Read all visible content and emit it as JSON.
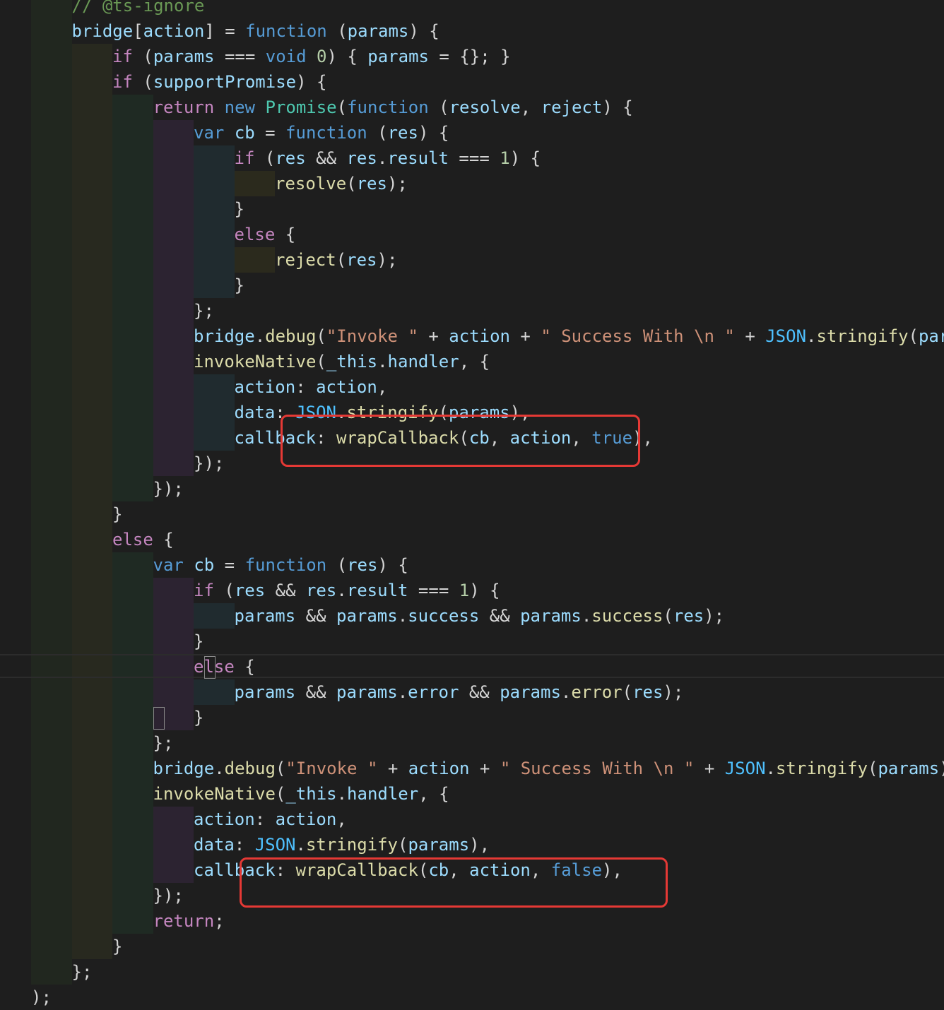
{
  "colors": {
    "background": "#1e1e1e",
    "text": "#d4d4d4",
    "comment": "#6a9955",
    "keyword": "#569cd6",
    "control": "#c586c0",
    "function": "#dcdcaa",
    "variable": "#9cdcfe",
    "string": "#ce9178",
    "number": "#b5cea8",
    "class": "#4ec9b0",
    "constant": "#4fc1ff",
    "highlight_box": "#e53935"
  },
  "lines": [
    {
      "indent": 1,
      "tokens": [
        {
          "t": "// @ts-ignore",
          "c": "comment"
        }
      ]
    },
    {
      "indent": 1,
      "tokens": [
        {
          "t": "bridge",
          "c": "variable"
        },
        {
          "t": "[",
          "c": "text"
        },
        {
          "t": "action",
          "c": "variable"
        },
        {
          "t": "] = ",
          "c": "text"
        },
        {
          "t": "function",
          "c": "keyword"
        },
        {
          "t": " (",
          "c": "text"
        },
        {
          "t": "params",
          "c": "variable"
        },
        {
          "t": ") {",
          "c": "text"
        }
      ]
    },
    {
      "indent": 2,
      "tokens": [
        {
          "t": "if",
          "c": "control"
        },
        {
          "t": " (",
          "c": "text"
        },
        {
          "t": "params",
          "c": "variable"
        },
        {
          "t": " === ",
          "c": "text"
        },
        {
          "t": "void",
          "c": "keyword"
        },
        {
          "t": " ",
          "c": "text"
        },
        {
          "t": "0",
          "c": "number"
        },
        {
          "t": ") { ",
          "c": "text"
        },
        {
          "t": "params",
          "c": "variable"
        },
        {
          "t": " = {}; }",
          "c": "text"
        }
      ]
    },
    {
      "indent": 2,
      "tokens": [
        {
          "t": "if",
          "c": "control"
        },
        {
          "t": " (",
          "c": "text"
        },
        {
          "t": "supportPromise",
          "c": "variable"
        },
        {
          "t": ") {",
          "c": "text"
        }
      ]
    },
    {
      "indent": 3,
      "tokens": [
        {
          "t": "return",
          "c": "control"
        },
        {
          "t": " ",
          "c": "text"
        },
        {
          "t": "new",
          "c": "keyword"
        },
        {
          "t": " ",
          "c": "text"
        },
        {
          "t": "Promise",
          "c": "class"
        },
        {
          "t": "(",
          "c": "text"
        },
        {
          "t": "function",
          "c": "keyword"
        },
        {
          "t": " (",
          "c": "text"
        },
        {
          "t": "resolve",
          "c": "variable"
        },
        {
          "t": ", ",
          "c": "text"
        },
        {
          "t": "reject",
          "c": "variable"
        },
        {
          "t": ") {",
          "c": "text"
        }
      ]
    },
    {
      "indent": 4,
      "tokens": [
        {
          "t": "var",
          "c": "keyword"
        },
        {
          "t": " ",
          "c": "text"
        },
        {
          "t": "cb",
          "c": "variable"
        },
        {
          "t": " = ",
          "c": "text"
        },
        {
          "t": "function",
          "c": "keyword"
        },
        {
          "t": " (",
          "c": "text"
        },
        {
          "t": "res",
          "c": "variable"
        },
        {
          "t": ") {",
          "c": "text"
        }
      ]
    },
    {
      "indent": 5,
      "tokens": [
        {
          "t": "if",
          "c": "control"
        },
        {
          "t": " (",
          "c": "text"
        },
        {
          "t": "res",
          "c": "variable"
        },
        {
          "t": " && ",
          "c": "text"
        },
        {
          "t": "res",
          "c": "variable"
        },
        {
          "t": ".",
          "c": "text"
        },
        {
          "t": "result",
          "c": "variable"
        },
        {
          "t": " === ",
          "c": "text"
        },
        {
          "t": "1",
          "c": "number"
        },
        {
          "t": ") {",
          "c": "text"
        }
      ]
    },
    {
      "indent": 6,
      "tokens": [
        {
          "t": "resolve",
          "c": "function"
        },
        {
          "t": "(",
          "c": "text"
        },
        {
          "t": "res",
          "c": "variable"
        },
        {
          "t": ");",
          "c": "text"
        }
      ]
    },
    {
      "indent": 5,
      "tokens": [
        {
          "t": "}",
          "c": "text"
        }
      ]
    },
    {
      "indent": 5,
      "tokens": [
        {
          "t": "else",
          "c": "control"
        },
        {
          "t": " {",
          "c": "text"
        }
      ]
    },
    {
      "indent": 6,
      "tokens": [
        {
          "t": "reject",
          "c": "function"
        },
        {
          "t": "(",
          "c": "text"
        },
        {
          "t": "res",
          "c": "variable"
        },
        {
          "t": ");",
          "c": "text"
        }
      ]
    },
    {
      "indent": 5,
      "tokens": [
        {
          "t": "}",
          "c": "text"
        }
      ]
    },
    {
      "indent": 4,
      "tokens": [
        {
          "t": "};",
          "c": "text"
        }
      ]
    },
    {
      "indent": 4,
      "tokens": [
        {
          "t": "bridge",
          "c": "variable"
        },
        {
          "t": ".",
          "c": "text"
        },
        {
          "t": "debug",
          "c": "function"
        },
        {
          "t": "(",
          "c": "text"
        },
        {
          "t": "\"Invoke \"",
          "c": "string"
        },
        {
          "t": " + ",
          "c": "text"
        },
        {
          "t": "action",
          "c": "variable"
        },
        {
          "t": " + ",
          "c": "text"
        },
        {
          "t": "\" Success With \\n \"",
          "c": "string"
        },
        {
          "t": " + ",
          "c": "text"
        },
        {
          "t": "JSON",
          "c": "constant"
        },
        {
          "t": ".",
          "c": "text"
        },
        {
          "t": "stringify",
          "c": "function"
        },
        {
          "t": "(",
          "c": "text"
        },
        {
          "t": "params",
          "c": "variable"
        },
        {
          "t": "));",
          "c": "text"
        }
      ]
    },
    {
      "indent": 4,
      "tokens": [
        {
          "t": "invokeNative",
          "c": "function"
        },
        {
          "t": "(",
          "c": "text"
        },
        {
          "t": "_this",
          "c": "variable"
        },
        {
          "t": ".",
          "c": "text"
        },
        {
          "t": "handler",
          "c": "variable"
        },
        {
          "t": ", {",
          "c": "text"
        }
      ]
    },
    {
      "indent": 5,
      "tokens": [
        {
          "t": "action",
          "c": "variable"
        },
        {
          "t": ": ",
          "c": "text"
        },
        {
          "t": "action",
          "c": "variable"
        },
        {
          "t": ",",
          "c": "text"
        }
      ]
    },
    {
      "indent": 5,
      "tokens": [
        {
          "t": "data",
          "c": "variable"
        },
        {
          "t": ": ",
          "c": "text"
        },
        {
          "t": "JSON",
          "c": "constant"
        },
        {
          "t": ".",
          "c": "text"
        },
        {
          "t": "stringify",
          "c": "function"
        },
        {
          "t": "(",
          "c": "text"
        },
        {
          "t": "params",
          "c": "variable"
        },
        {
          "t": "),",
          "c": "text"
        }
      ]
    },
    {
      "indent": 5,
      "tokens": [
        {
          "t": "callback",
          "c": "variable"
        },
        {
          "t": ": ",
          "c": "text"
        },
        {
          "t": "wrapCallback",
          "c": "function"
        },
        {
          "t": "(",
          "c": "text"
        },
        {
          "t": "cb",
          "c": "variable"
        },
        {
          "t": ", ",
          "c": "text"
        },
        {
          "t": "action",
          "c": "variable"
        },
        {
          "t": ", ",
          "c": "text"
        },
        {
          "t": "true",
          "c": "keyword"
        },
        {
          "t": "),",
          "c": "text"
        }
      ]
    },
    {
      "indent": 4,
      "tokens": [
        {
          "t": "});",
          "c": "text"
        }
      ]
    },
    {
      "indent": 3,
      "tokens": [
        {
          "t": "});",
          "c": "text"
        }
      ]
    },
    {
      "indent": 2,
      "tokens": [
        {
          "t": "}",
          "c": "text"
        }
      ]
    },
    {
      "indent": 2,
      "tokens": [
        {
          "t": "else",
          "c": "control"
        },
        {
          "t": " {",
          "c": "text"
        }
      ]
    },
    {
      "indent": 3,
      "tokens": [
        {
          "t": "var",
          "c": "keyword"
        },
        {
          "t": " ",
          "c": "text"
        },
        {
          "t": "cb",
          "c": "variable"
        },
        {
          "t": " = ",
          "c": "text"
        },
        {
          "t": "function",
          "c": "keyword"
        },
        {
          "t": " (",
          "c": "text"
        },
        {
          "t": "res",
          "c": "variable"
        },
        {
          "t": ") {",
          "c": "text"
        }
      ]
    },
    {
      "indent": 4,
      "tokens": [
        {
          "t": "if",
          "c": "control"
        },
        {
          "t": " (",
          "c": "text"
        },
        {
          "t": "res",
          "c": "variable"
        },
        {
          "t": " && ",
          "c": "text"
        },
        {
          "t": "res",
          "c": "variable"
        },
        {
          "t": ".",
          "c": "text"
        },
        {
          "t": "result",
          "c": "variable"
        },
        {
          "t": " === ",
          "c": "text"
        },
        {
          "t": "1",
          "c": "number"
        },
        {
          "t": ") {",
          "c": "text"
        }
      ]
    },
    {
      "indent": 5,
      "tokens": [
        {
          "t": "params",
          "c": "variable"
        },
        {
          "t": " && ",
          "c": "text"
        },
        {
          "t": "params",
          "c": "variable"
        },
        {
          "t": ".",
          "c": "text"
        },
        {
          "t": "success",
          "c": "variable"
        },
        {
          "t": " && ",
          "c": "text"
        },
        {
          "t": "params",
          "c": "variable"
        },
        {
          "t": ".",
          "c": "text"
        },
        {
          "t": "success",
          "c": "function"
        },
        {
          "t": "(",
          "c": "text"
        },
        {
          "t": "res",
          "c": "variable"
        },
        {
          "t": ");",
          "c": "text"
        }
      ]
    },
    {
      "indent": 4,
      "tokens": [
        {
          "t": "}",
          "c": "text"
        }
      ]
    },
    {
      "indent": 4,
      "tokens": [
        {
          "t": "else",
          "c": "control"
        },
        {
          "t": " {",
          "c": "text"
        }
      ]
    },
    {
      "indent": 5,
      "tokens": [
        {
          "t": "params",
          "c": "variable"
        },
        {
          "t": " && ",
          "c": "text"
        },
        {
          "t": "params",
          "c": "variable"
        },
        {
          "t": ".",
          "c": "text"
        },
        {
          "t": "error",
          "c": "variable"
        },
        {
          "t": " && ",
          "c": "text"
        },
        {
          "t": "params",
          "c": "variable"
        },
        {
          "t": ".",
          "c": "text"
        },
        {
          "t": "error",
          "c": "function"
        },
        {
          "t": "(",
          "c": "text"
        },
        {
          "t": "res",
          "c": "variable"
        },
        {
          "t": ");",
          "c": "text"
        }
      ]
    },
    {
      "indent": 4,
      "tokens": [
        {
          "t": "}",
          "c": "text"
        }
      ]
    },
    {
      "indent": 3,
      "tokens": [
        {
          "t": "};",
          "c": "text"
        }
      ]
    },
    {
      "indent": 3,
      "tokens": [
        {
          "t": "bridge",
          "c": "variable"
        },
        {
          "t": ".",
          "c": "text"
        },
        {
          "t": "debug",
          "c": "function"
        },
        {
          "t": "(",
          "c": "text"
        },
        {
          "t": "\"Invoke \"",
          "c": "string"
        },
        {
          "t": " + ",
          "c": "text"
        },
        {
          "t": "action",
          "c": "variable"
        },
        {
          "t": " + ",
          "c": "text"
        },
        {
          "t": "\" Success With \\n \"",
          "c": "string"
        },
        {
          "t": " + ",
          "c": "text"
        },
        {
          "t": "JSON",
          "c": "constant"
        },
        {
          "t": ".",
          "c": "text"
        },
        {
          "t": "stringify",
          "c": "function"
        },
        {
          "t": "(",
          "c": "text"
        },
        {
          "t": "params",
          "c": "variable"
        },
        {
          "t": "));",
          "c": "text"
        }
      ]
    },
    {
      "indent": 3,
      "tokens": [
        {
          "t": "invokeNative",
          "c": "function"
        },
        {
          "t": "(",
          "c": "text"
        },
        {
          "t": "_this",
          "c": "variable"
        },
        {
          "t": ".",
          "c": "text"
        },
        {
          "t": "handler",
          "c": "variable"
        },
        {
          "t": ", {",
          "c": "text"
        }
      ]
    },
    {
      "indent": 4,
      "tokens": [
        {
          "t": "action",
          "c": "variable"
        },
        {
          "t": ": ",
          "c": "text"
        },
        {
          "t": "action",
          "c": "variable"
        },
        {
          "t": ",",
          "c": "text"
        }
      ]
    },
    {
      "indent": 4,
      "tokens": [
        {
          "t": "data",
          "c": "variable"
        },
        {
          "t": ": ",
          "c": "text"
        },
        {
          "t": "JSON",
          "c": "constant"
        },
        {
          "t": ".",
          "c": "text"
        },
        {
          "t": "stringify",
          "c": "function"
        },
        {
          "t": "(",
          "c": "text"
        },
        {
          "t": "params",
          "c": "variable"
        },
        {
          "t": "),",
          "c": "text"
        }
      ]
    },
    {
      "indent": 4,
      "tokens": [
        {
          "t": "callback",
          "c": "variable"
        },
        {
          "t": ": ",
          "c": "text"
        },
        {
          "t": "wrapCallback",
          "c": "function"
        },
        {
          "t": "(",
          "c": "text"
        },
        {
          "t": "cb",
          "c": "variable"
        },
        {
          "t": ", ",
          "c": "text"
        },
        {
          "t": "action",
          "c": "variable"
        },
        {
          "t": ", ",
          "c": "text"
        },
        {
          "t": "false",
          "c": "keyword"
        },
        {
          "t": "),",
          "c": "text"
        }
      ]
    },
    {
      "indent": 3,
      "tokens": [
        {
          "t": "});",
          "c": "text"
        }
      ]
    },
    {
      "indent": 3,
      "tokens": [
        {
          "t": "return",
          "c": "control"
        },
        {
          "t": ";",
          "c": "text"
        }
      ]
    },
    {
      "indent": 2,
      "tokens": [
        {
          "t": "}",
          "c": "text"
        }
      ]
    },
    {
      "indent": 1,
      "tokens": [
        {
          "t": "};",
          "c": "text"
        }
      ]
    },
    {
      "indent": 0,
      "tokens": [
        {
          "t": ");",
          "c": "text"
        }
      ]
    }
  ]
}
